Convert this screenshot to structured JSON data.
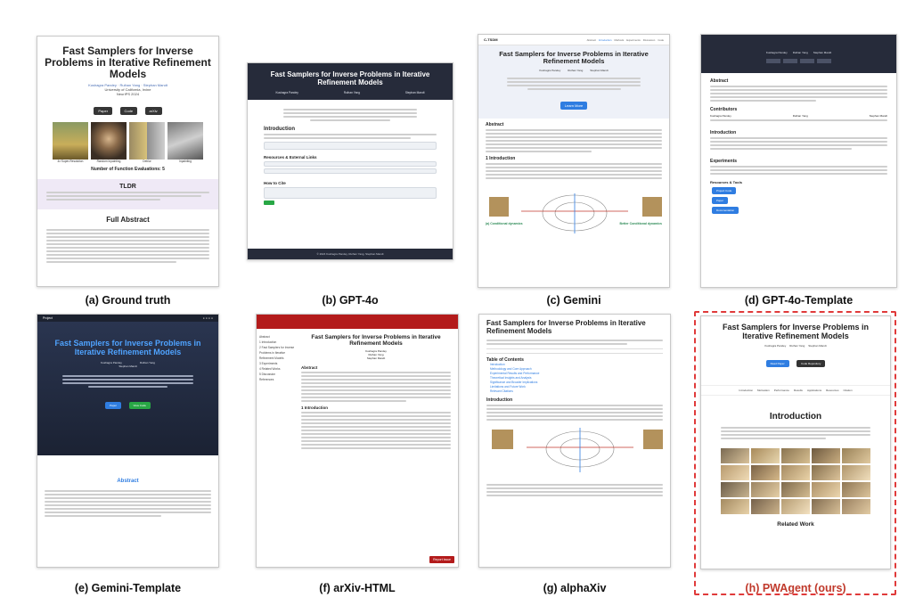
{
  "paper_title": "Fast Samplers for Inverse Problems in Iterative Refinement Models",
  "authors": [
    "Kushagra Pandey",
    "Ruihan Yang",
    "Stephan Mandt"
  ],
  "captions": {
    "a": "(a) Ground truth",
    "b": "(b) GPT-4o",
    "c": "(c) Gemini",
    "d": "(d) GPT-4o-Template",
    "e": "(e) Gemini-Template",
    "f": "(f) arXiv-HTML",
    "g": "(g) alphaXiv",
    "h": "(h) PWAgent (ours)"
  },
  "a": {
    "venue": "University of California, Irvine",
    "conf": "NeurIPS 2024",
    "buttons": [
      "Paper",
      "Code",
      "arXiv"
    ],
    "image_labels": [
      "4x Super-Resolution",
      "Random Inpainting",
      "Deblur",
      "Inpainting"
    ],
    "number_line": "Number of Function Evaluations: 5",
    "tldr": "TLDR",
    "full_abstract": "Full Abstract"
  },
  "b": {
    "section_intro": "Introduction",
    "section_resources": "Resources & External Links",
    "section_cite": "How to Cite",
    "footer": "© 2024 Kushagra Pandey, Ruihan Yang, Stephan Mandt"
  },
  "c": {
    "logo": "C-TSDM",
    "nav": [
      "Abstract",
      "Introduction",
      "Methods",
      "Experiments",
      "Discussion",
      "Code"
    ],
    "abstract": "Abstract",
    "intro": "1 Introduction",
    "btn": "Learn More",
    "fig_left": "(a) Conditional dynamics",
    "fig_right": "Better Conditional dynamics"
  },
  "d": {
    "abstract": "Abstract",
    "contributors": "Contributors",
    "intro": "Introduction",
    "experiments": "Experiments",
    "resources": "Resources & Tools",
    "links": [
      "Project Code",
      "Paper",
      "Documentation"
    ]
  },
  "e": {
    "brand": "Project",
    "abstract": "Abstract",
    "btn1": "Paper",
    "btn2": "View Code"
  },
  "f": {
    "toc": [
      "Abstract",
      "1 Introduction",
      "2 Fast Samplers for Inverse Problems in Iterative Refinement Models",
      "3 Experiments",
      "4 Related Works",
      "5 Discussion",
      "References"
    ],
    "abstract": "Abstract",
    "intro": "1 Introduction",
    "report": "Report Issue"
  },
  "g": {
    "toc_title": "Table of Contents",
    "intro": "Introduction",
    "toc": [
      "Introduction",
      "Methodology and Core Approach",
      "Experimental Results and Performance",
      "Theoretical Insights and Analysis",
      "Significance and Broader Implications",
      "Limitations and Future Work",
      "Relevant Citations"
    ]
  },
  "h": {
    "buttons": [
      "Read Paper",
      "Code Repository"
    ],
    "nav": [
      "Introduction",
      "Motivation",
      "Performance",
      "Results",
      "Applications",
      "Resources",
      "Citation"
    ],
    "intro": "Introduction",
    "related": "Related Work"
  },
  "colors": {
    "dark_header": "#262b3a",
    "accent_blue": "#2f7de1",
    "accent_green": "#28a745",
    "arxiv_red": "#b31b1b",
    "tldr_bg": "#efe9f6",
    "dash_red": "#e03a3a"
  }
}
